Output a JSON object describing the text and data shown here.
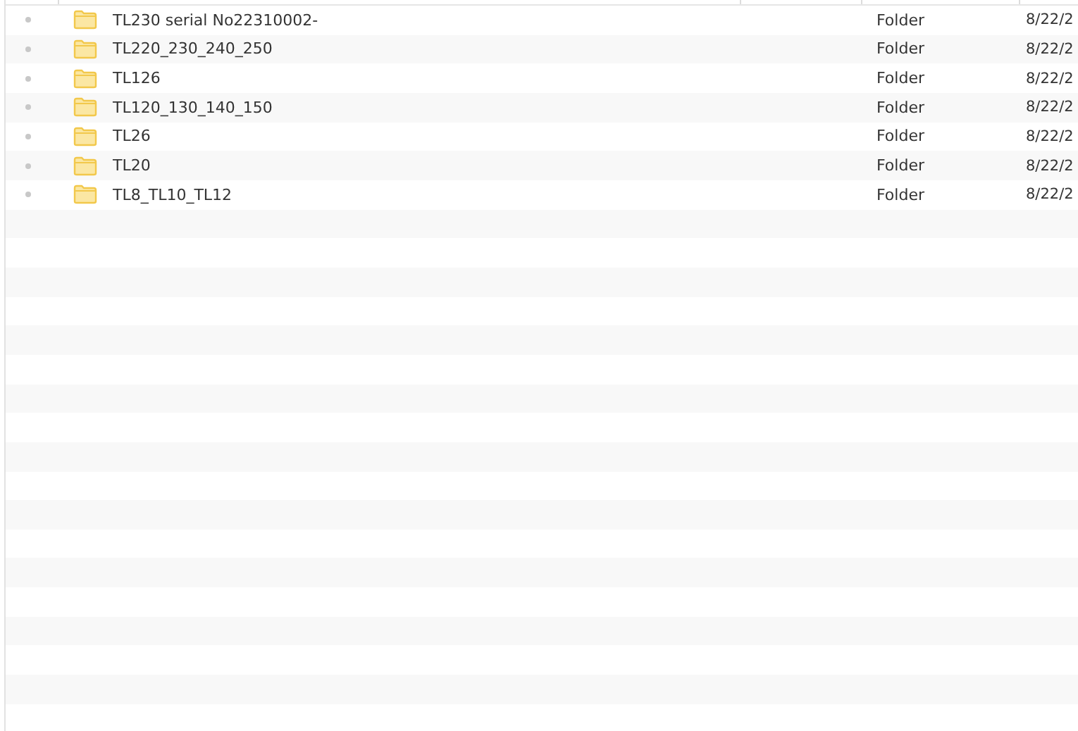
{
  "rows": [
    {
      "name": "TL230 serial No22310002-",
      "type": "Folder",
      "date": "8/22/2"
    },
    {
      "name": "TL220_230_240_250",
      "type": "Folder",
      "date": "8/22/2"
    },
    {
      "name": "TL126",
      "type": "Folder",
      "date": "8/22/2"
    },
    {
      "name": "TL120_130_140_150",
      "type": "Folder",
      "date": "8/22/2"
    },
    {
      "name": "TL26",
      "type": "Folder",
      "date": "8/22/2"
    },
    {
      "name": "TL20",
      "type": "Folder",
      "date": "8/22/2"
    },
    {
      "name": "TL8_TL10_TL12",
      "type": "Folder",
      "date": "8/22/2"
    }
  ]
}
